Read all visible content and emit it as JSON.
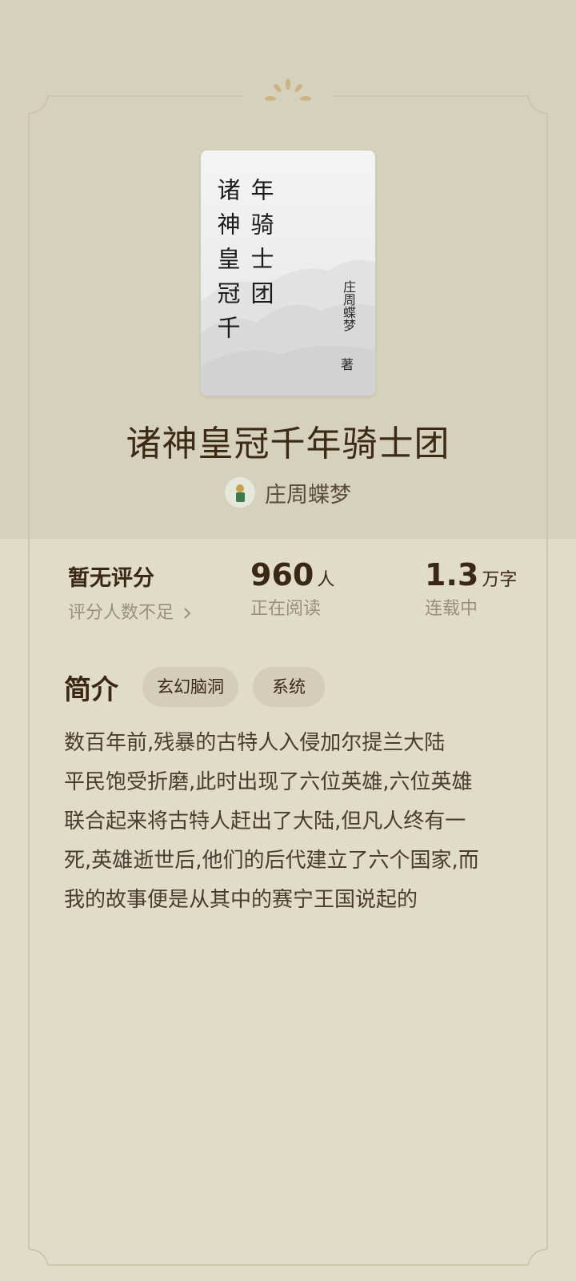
{
  "book": {
    "title": "诸神皇冠千年骑士团",
    "cover_col1": "诸神皇冠千",
    "cover_col2": "年骑士团",
    "cover_author": "庄周蝶梦",
    "cover_zhu": "著",
    "author": "庄周蝶梦"
  },
  "stats": {
    "rating": {
      "label": "暂无评分",
      "sub": "评分人数不足"
    },
    "readers": {
      "value": "960",
      "unit": "人",
      "sub": "正在阅读"
    },
    "words": {
      "value": "1.3",
      "unit": "万字",
      "sub": "连载中"
    }
  },
  "intro": {
    "title": "简介",
    "tags": [
      "玄幻脑洞",
      "系统"
    ],
    "lines": [
      "数百年前,残暴的古特人入侵加尔提兰大陆",
      "平民饱受折磨,此时出现了六位英雄,六位英雄",
      "联合起来将古特人赶出了大陆,但凡人终有一",
      "死,英雄逝世后,他们的后代建立了六个国家,而",
      "我的故事便是从其中的赛宁王国说起的"
    ]
  },
  "icons": {
    "chevron": "chevron-right-icon",
    "ornament": "sun-ornament-icon"
  },
  "colors": {
    "background": "#e1dcc8",
    "top_band": "#d6d1bd",
    "frame": "#cfc6a9",
    "accent": "#c9b98c"
  }
}
